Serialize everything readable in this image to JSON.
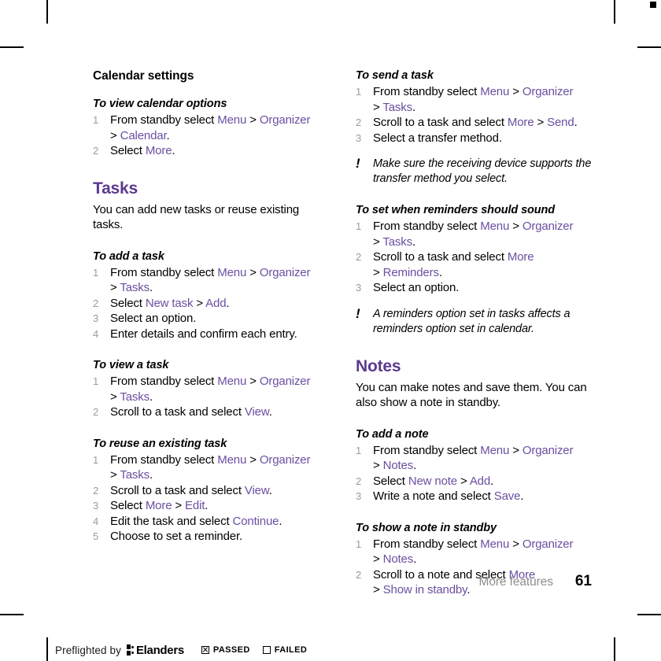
{
  "document": {
    "page_number": "61",
    "running_header": "More features"
  },
  "left_column": {
    "section_heading": "Calendar settings",
    "procedures": [
      {
        "title": "To view calendar options",
        "steps": [
          {
            "num": "1",
            "parts": [
              {
                "t": "text",
                "v": "From standby select "
              },
              {
                "t": "ui",
                "v": "Menu"
              },
              {
                "t": "sep",
                "v": " > "
              },
              {
                "t": "ui",
                "v": "Organizer"
              },
              {
                "t": "br"
              },
              {
                "t": "sep",
                "v": "> "
              },
              {
                "t": "ui",
                "v": "Calendar"
              },
              {
                "t": "text",
                "v": "."
              }
            ]
          },
          {
            "num": "2",
            "parts": [
              {
                "t": "text",
                "v": "Select "
              },
              {
                "t": "ui",
                "v": "More"
              },
              {
                "t": "text",
                "v": "."
              }
            ]
          }
        ]
      }
    ],
    "chapter": {
      "title": "Tasks",
      "intro": "You can add new tasks or reuse existing tasks."
    },
    "chapter_procedures": [
      {
        "title": "To add a task",
        "steps": [
          {
            "num": "1",
            "parts": [
              {
                "t": "text",
                "v": "From standby select "
              },
              {
                "t": "ui",
                "v": "Menu"
              },
              {
                "t": "sep",
                "v": " > "
              },
              {
                "t": "ui",
                "v": "Organizer"
              },
              {
                "t": "br"
              },
              {
                "t": "sep",
                "v": "> "
              },
              {
                "t": "ui",
                "v": "Tasks"
              },
              {
                "t": "text",
                "v": "."
              }
            ]
          },
          {
            "num": "2",
            "parts": [
              {
                "t": "text",
                "v": "Select "
              },
              {
                "t": "ui",
                "v": "New task"
              },
              {
                "t": "sep",
                "v": " > "
              },
              {
                "t": "ui",
                "v": "Add"
              },
              {
                "t": "text",
                "v": "."
              }
            ]
          },
          {
            "num": "3",
            "parts": [
              {
                "t": "text",
                "v": "Select an option."
              }
            ]
          },
          {
            "num": "4",
            "parts": [
              {
                "t": "text",
                "v": "Enter details and confirm each entry."
              }
            ]
          }
        ]
      },
      {
        "title": "To view a task",
        "steps": [
          {
            "num": "1",
            "parts": [
              {
                "t": "text",
                "v": "From standby select "
              },
              {
                "t": "ui",
                "v": "Menu"
              },
              {
                "t": "sep",
                "v": " > "
              },
              {
                "t": "ui",
                "v": "Organizer"
              },
              {
                "t": "br"
              },
              {
                "t": "sep",
                "v": "> "
              },
              {
                "t": "ui",
                "v": "Tasks"
              },
              {
                "t": "text",
                "v": "."
              }
            ]
          },
          {
            "num": "2",
            "parts": [
              {
                "t": "text",
                "v": "Scroll to a task and select "
              },
              {
                "t": "ui",
                "v": "View"
              },
              {
                "t": "text",
                "v": "."
              }
            ]
          }
        ]
      },
      {
        "title": "To reuse an existing task",
        "steps": [
          {
            "num": "1",
            "parts": [
              {
                "t": "text",
                "v": "From standby select "
              },
              {
                "t": "ui",
                "v": "Menu"
              },
              {
                "t": "sep",
                "v": " > "
              },
              {
                "t": "ui",
                "v": "Organizer"
              },
              {
                "t": "br"
              },
              {
                "t": "sep",
                "v": "> "
              },
              {
                "t": "ui",
                "v": "Tasks"
              },
              {
                "t": "text",
                "v": "."
              }
            ]
          },
          {
            "num": "2",
            "parts": [
              {
                "t": "text",
                "v": "Scroll to a task and select "
              },
              {
                "t": "ui",
                "v": "View"
              },
              {
                "t": "text",
                "v": "."
              }
            ]
          },
          {
            "num": "3",
            "parts": [
              {
                "t": "text",
                "v": "Select "
              },
              {
                "t": "ui",
                "v": "More"
              },
              {
                "t": "sep",
                "v": " > "
              },
              {
                "t": "ui",
                "v": "Edit"
              },
              {
                "t": "text",
                "v": "."
              }
            ]
          },
          {
            "num": "4",
            "parts": [
              {
                "t": "text",
                "v": "Edit the task and select "
              },
              {
                "t": "ui",
                "v": "Continue"
              },
              {
                "t": "text",
                "v": "."
              }
            ]
          },
          {
            "num": "5",
            "parts": [
              {
                "t": "text",
                "v": "Choose to set a reminder."
              }
            ]
          }
        ]
      }
    ]
  },
  "right_column": {
    "blocks": [
      {
        "kind": "procedure",
        "title": "To send a task",
        "steps": [
          {
            "num": "1",
            "parts": [
              {
                "t": "text",
                "v": "From standby select "
              },
              {
                "t": "ui",
                "v": "Menu"
              },
              {
                "t": "sep",
                "v": " > "
              },
              {
                "t": "ui",
                "v": "Organizer"
              },
              {
                "t": "br"
              },
              {
                "t": "sep",
                "v": "> "
              },
              {
                "t": "ui",
                "v": "Tasks"
              },
              {
                "t": "text",
                "v": "."
              }
            ]
          },
          {
            "num": "2",
            "parts": [
              {
                "t": "text",
                "v": "Scroll to a task and select "
              },
              {
                "t": "ui",
                "v": "More"
              },
              {
                "t": "sep",
                "v": " > "
              },
              {
                "t": "ui",
                "v": "Send"
              },
              {
                "t": "text",
                "v": "."
              }
            ]
          },
          {
            "num": "3",
            "parts": [
              {
                "t": "text",
                "v": "Select a transfer method."
              }
            ]
          }
        ]
      },
      {
        "kind": "tip",
        "icon": "exclamation-icon",
        "text": "Make sure the receiving device supports the transfer method you select."
      },
      {
        "kind": "procedure",
        "title": "To set when reminders should sound",
        "steps": [
          {
            "num": "1",
            "parts": [
              {
                "t": "text",
                "v": "From standby select "
              },
              {
                "t": "ui",
                "v": "Menu"
              },
              {
                "t": "sep",
                "v": " > "
              },
              {
                "t": "ui",
                "v": "Organizer"
              },
              {
                "t": "br"
              },
              {
                "t": "sep",
                "v": "> "
              },
              {
                "t": "ui",
                "v": "Tasks"
              },
              {
                "t": "text",
                "v": "."
              }
            ]
          },
          {
            "num": "2",
            "parts": [
              {
                "t": "text",
                "v": "Scroll to a task and select "
              },
              {
                "t": "ui",
                "v": "More"
              },
              {
                "t": "br"
              },
              {
                "t": "sep",
                "v": "> "
              },
              {
                "t": "ui",
                "v": "Reminders"
              },
              {
                "t": "text",
                "v": "."
              }
            ]
          },
          {
            "num": "3",
            "parts": [
              {
                "t": "text",
                "v": "Select an option."
              }
            ]
          }
        ]
      },
      {
        "kind": "tip",
        "icon": "exclamation-icon",
        "text": "A reminders option set in tasks affects a reminders option set in calendar."
      },
      {
        "kind": "chapter",
        "title": "Notes",
        "intro": "You can make notes and save them. You can also show a note in standby."
      },
      {
        "kind": "procedure",
        "title": "To add a note",
        "steps": [
          {
            "num": "1",
            "parts": [
              {
                "t": "text",
                "v": "From standby select "
              },
              {
                "t": "ui",
                "v": "Menu"
              },
              {
                "t": "sep",
                "v": " > "
              },
              {
                "t": "ui",
                "v": "Organizer"
              },
              {
                "t": "br"
              },
              {
                "t": "sep",
                "v": "> "
              },
              {
                "t": "ui",
                "v": "Notes"
              },
              {
                "t": "text",
                "v": "."
              }
            ]
          },
          {
            "num": "2",
            "parts": [
              {
                "t": "text",
                "v": "Select "
              },
              {
                "t": "ui",
                "v": "New note"
              },
              {
                "t": "sep",
                "v": " > "
              },
              {
                "t": "ui",
                "v": "Add"
              },
              {
                "t": "text",
                "v": "."
              }
            ]
          },
          {
            "num": "3",
            "parts": [
              {
                "t": "text",
                "v": "Write a note and select "
              },
              {
                "t": "ui",
                "v": "Save"
              },
              {
                "t": "text",
                "v": "."
              }
            ]
          }
        ]
      },
      {
        "kind": "procedure",
        "title": "To show a note in standby",
        "steps": [
          {
            "num": "1",
            "parts": [
              {
                "t": "text",
                "v": "From standby select "
              },
              {
                "t": "ui",
                "v": "Menu"
              },
              {
                "t": "sep",
                "v": " > "
              },
              {
                "t": "ui",
                "v": "Organizer"
              },
              {
                "t": "br"
              },
              {
                "t": "sep",
                "v": "> "
              },
              {
                "t": "ui",
                "v": "Notes"
              },
              {
                "t": "text",
                "v": "."
              }
            ]
          },
          {
            "num": "2",
            "parts": [
              {
                "t": "text",
                "v": "Scroll to a note and select "
              },
              {
                "t": "ui",
                "v": "More"
              },
              {
                "t": "br"
              },
              {
                "t": "sep",
                "v": "> "
              },
              {
                "t": "ui",
                "v": "Show in standby"
              },
              {
                "t": "text",
                "v": "."
              }
            ]
          }
        ]
      }
    ]
  },
  "preflight": {
    "label": "Preflighted by",
    "brand": "Elanders",
    "passed_label": "PASSED",
    "passed_checked": true,
    "failed_label": "FAILED",
    "failed_checked": false
  },
  "colors": {
    "ui_purple": "#6b4fa0",
    "chapter_purple": "#5b3a8e",
    "step_number_gray": "#9b9b9b",
    "footer_gray": "#8d8d8d"
  }
}
